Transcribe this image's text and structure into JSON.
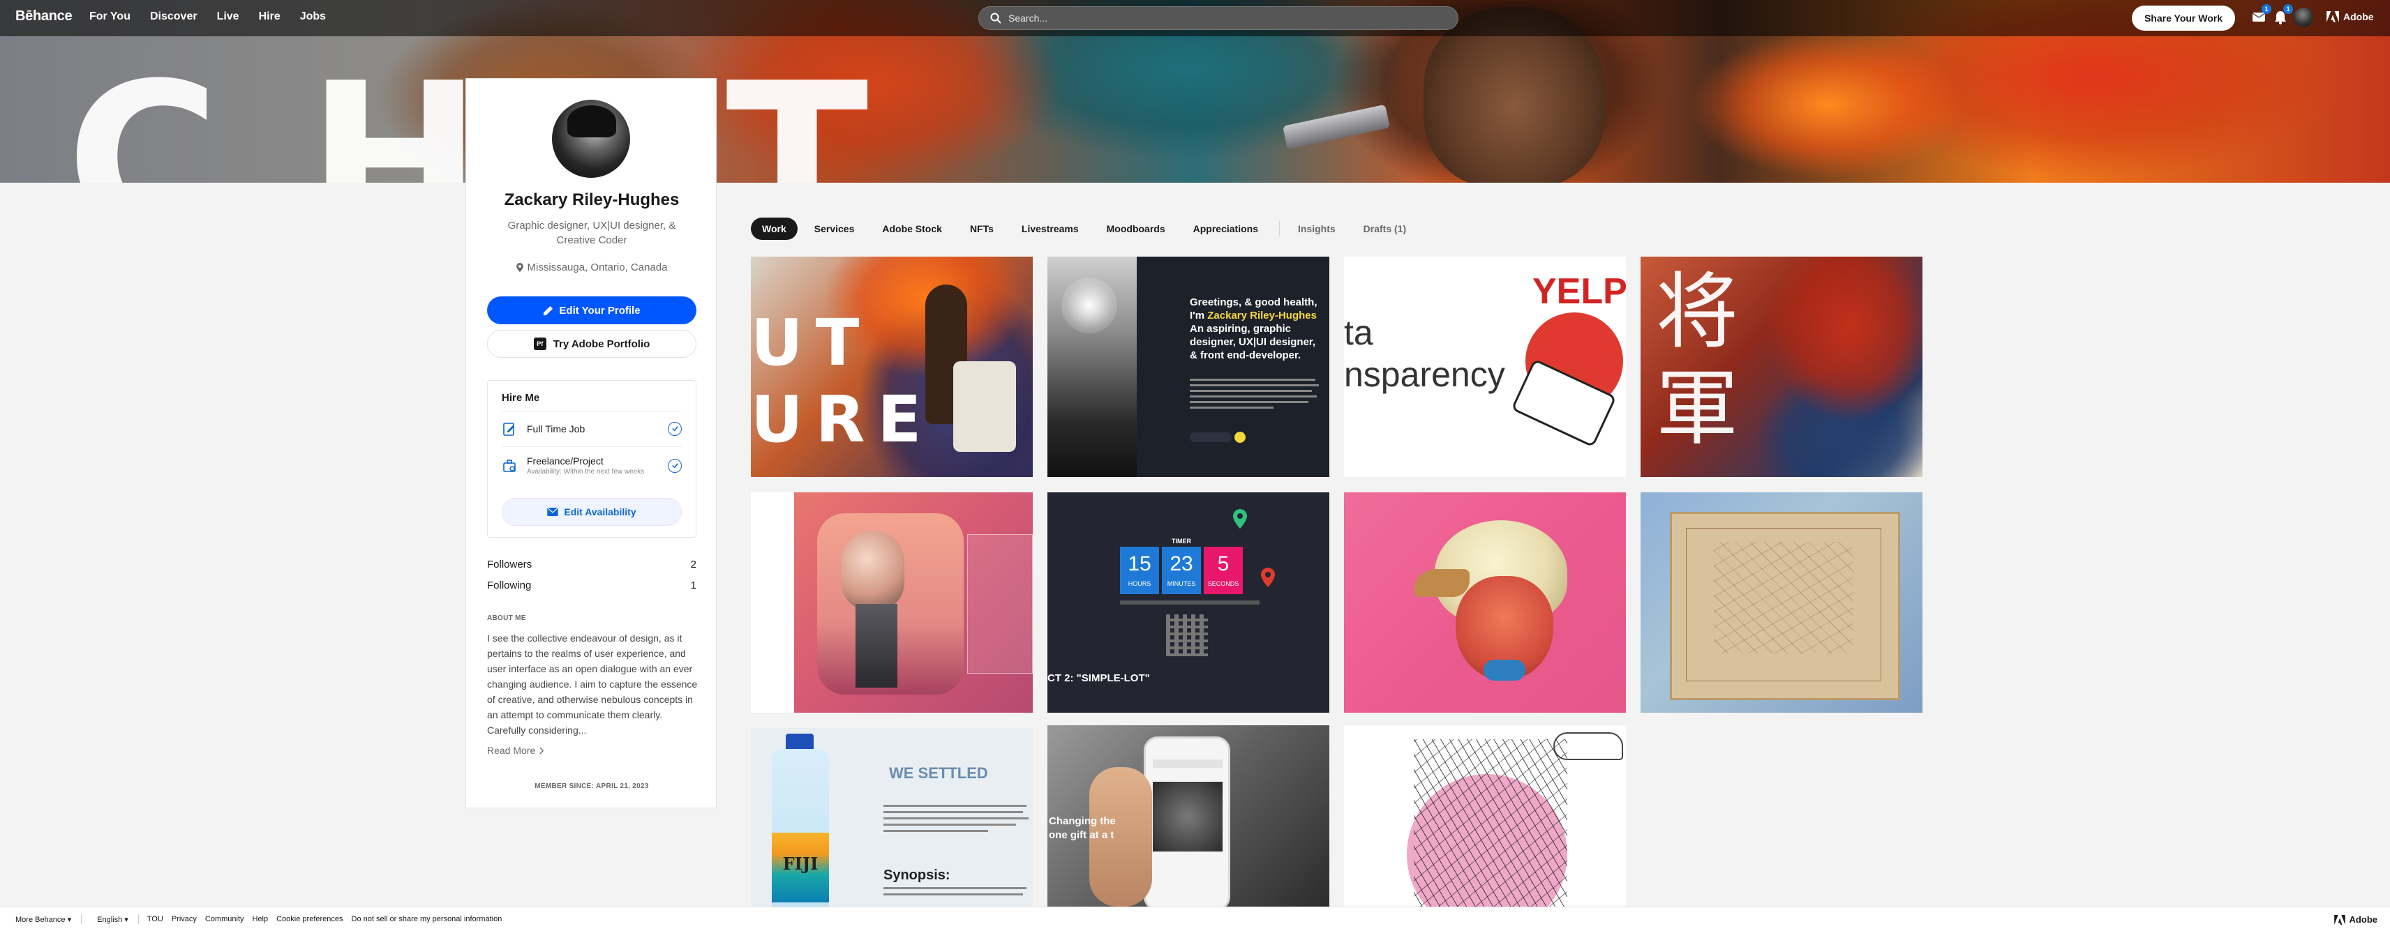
{
  "nav": {
    "logo": "Bēhance",
    "links": [
      "For You",
      "Discover",
      "Live",
      "Hire",
      "Jobs"
    ],
    "search_placeholder": "Search...",
    "share_button": "Share Your Work",
    "notification_badges": [
      "1",
      "1"
    ],
    "adobe_label": "Adobe"
  },
  "profile": {
    "name": "Zackary Riley-Hughes",
    "title": "Graphic designer, UX|UI designer, & Creative Coder",
    "location": "Mississauga, Ontario, Canada",
    "edit_profile": "Edit Your Profile",
    "portfolio_button": "Try Adobe Portfolio",
    "portfolio_icon_text": "Pf",
    "hire_me": {
      "title": "Hire Me",
      "items": [
        {
          "label": "Full Time Job",
          "sub": ""
        },
        {
          "label": "Freelance/Project",
          "sub": "Availability: Within the next few weeks"
        }
      ],
      "edit_availability": "Edit Availability"
    },
    "followers_label": "Followers",
    "followers_count": "2",
    "following_label": "Following",
    "following_count": "1",
    "about_title": "ABOUT ME",
    "about_text": "I see the collective endeavour of design, as it pertains to the realms of user experience, and user interface as an open dialogue with an ever changing audience. I aim to capture the essence of creative, and otherwise nebulous concepts in an attempt to communicate them clearly. Carefully considering...",
    "read_more": "Read More",
    "member_since": "MEMBER SINCE: APRIL 21, 2023"
  },
  "tabs": {
    "primary": [
      "Work",
      "Services",
      "Adobe Stock",
      "NFTs",
      "Livestreams",
      "Moodboards",
      "Appreciations"
    ],
    "secondary": [
      "Insights",
      "Drafts (1)"
    ],
    "active": "Work"
  },
  "projects": {
    "t2": {
      "greeting": "Greetings, & good health,",
      "im": "I'm ",
      "name": "Zackary Riley-Hughes",
      "line2": "An aspiring, graphic designer, UX|UI designer, & front end-developer."
    },
    "t3": {
      "word1": "ta",
      "word2": "nsparency",
      "brand": "YELP"
    },
    "t6": {
      "timer_label": "TIMER",
      "units": [
        {
          "value": "15",
          "label": "HOURS"
        },
        {
          "value": "23",
          "label": "MINUTES"
        },
        {
          "value": "5",
          "label": "SECONDS"
        }
      ],
      "caption": "CT 2: \"SIMPLE-LOT\""
    },
    "t9": {
      "heading": "WE SETTLED",
      "synopsis": "Synopsis:",
      "bottle": "FIJI"
    },
    "t10": {
      "caption1": "Changing the",
      "caption2": "one gift at a t"
    }
  },
  "footer": {
    "more": "More Behance",
    "lang": "English",
    "links": [
      "TOU",
      "Privacy",
      "Community",
      "Help",
      "Cookie preferences",
      "Do not sell or share my personal information"
    ],
    "adobe": "Adobe"
  },
  "colors": {
    "primary_blue": "#0057ff",
    "accent_blue": "#0d66d0",
    "timer_blue": "#1e7ad6",
    "timer_pink": "#e8176b",
    "yelp_red": "#d32323"
  }
}
